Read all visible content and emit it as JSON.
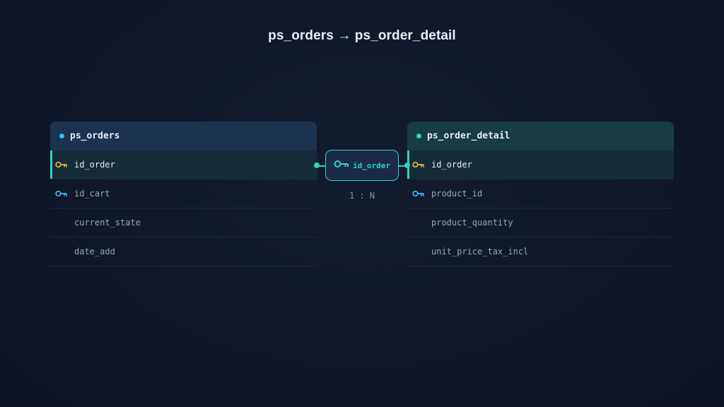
{
  "title": "ps_orders → ps_order_detail",
  "colors": {
    "background": "#0f1729",
    "accent": "#2dd4bf",
    "primary_key": "#f5b82e",
    "foreign_key": "#38bdf8",
    "left_header": "#1a3350",
    "right_header": "#173c45"
  },
  "tables": {
    "left": {
      "name": "ps_orders",
      "columns": [
        {
          "name": "id_order",
          "key": "primary-key-icon",
          "linked": true
        },
        {
          "name": "id_cart",
          "key": "foreign-key-icon",
          "linked": false
        },
        {
          "name": "current_state",
          "key": "",
          "linked": false
        },
        {
          "name": "date_add",
          "key": "",
          "linked": false
        }
      ]
    },
    "right": {
      "name": "ps_order_detail",
      "columns": [
        {
          "name": "id_order",
          "key": "primary-key-icon",
          "linked": true
        },
        {
          "name": "product_id",
          "key": "foreign-key-icon",
          "linked": false
        },
        {
          "name": "product_quantity",
          "key": "",
          "linked": false
        },
        {
          "name": "unit_price_tax_incl",
          "key": "",
          "linked": false
        }
      ]
    }
  },
  "relationship": {
    "label": "id_order",
    "icon": "key-icon",
    "cardinality": "1 : N"
  }
}
